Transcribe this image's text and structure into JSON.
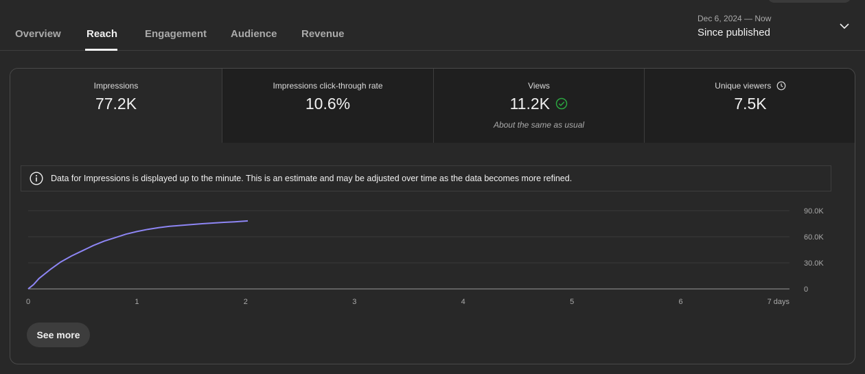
{
  "tabs": [
    {
      "label": "Overview"
    },
    {
      "label": "Reach"
    },
    {
      "label": "Engagement"
    },
    {
      "label": "Audience"
    },
    {
      "label": "Revenue"
    }
  ],
  "active_tab": "Reach",
  "date_range": {
    "range": "Dec 6, 2024 — Now",
    "label": "Since published"
  },
  "metrics": [
    {
      "label": "Impressions",
      "value": "77.2K"
    },
    {
      "label": "Impressions click-through rate",
      "value": "10.6%"
    },
    {
      "label": "Views",
      "value": "11.2K",
      "note": "About the same as usual",
      "status": "check-circle-icon"
    },
    {
      "label": "Unique viewers",
      "value": "7.5K",
      "status": "clock-icon"
    }
  ],
  "info_banner": {
    "text": "Data for Impressions is displayed up to the minute. This is an estimate and may be adjusted over time as the data becomes more refined."
  },
  "see_more_label": "See more",
  "colors": {
    "line": "#8e86f5",
    "check": "#2ba640",
    "background": "#282828"
  },
  "chart_data": {
    "type": "line",
    "series": [
      {
        "values": [
          [
            0,
            0
          ],
          [
            0.05,
            5000
          ],
          [
            0.1,
            12000
          ],
          [
            0.2,
            22000
          ],
          [
            0.3,
            31000
          ],
          [
            0.4,
            38000
          ],
          [
            0.5,
            44000
          ],
          [
            0.6,
            50000
          ],
          [
            0.7,
            55000
          ],
          [
            0.8,
            59000
          ],
          [
            0.9,
            63000
          ],
          [
            1.0,
            66000
          ],
          [
            1.1,
            68500
          ],
          [
            1.2,
            70500
          ],
          [
            1.3,
            72000
          ],
          [
            1.4,
            73000
          ],
          [
            1.5,
            74000
          ],
          [
            1.6,
            75000
          ],
          [
            1.7,
            75800
          ],
          [
            1.8,
            76600
          ],
          [
            1.9,
            77200
          ],
          [
            2.02,
            78200
          ]
        ]
      }
    ],
    "x_ticks": [
      "0",
      "1",
      "2",
      "3",
      "4",
      "5",
      "6",
      "7 days"
    ],
    "y_ticks": [
      "90.0K",
      "60.0K",
      "30.0K",
      "0"
    ],
    "xlim": [
      0,
      7
    ],
    "ylim": [
      0,
      90000
    ],
    "grid": true
  }
}
